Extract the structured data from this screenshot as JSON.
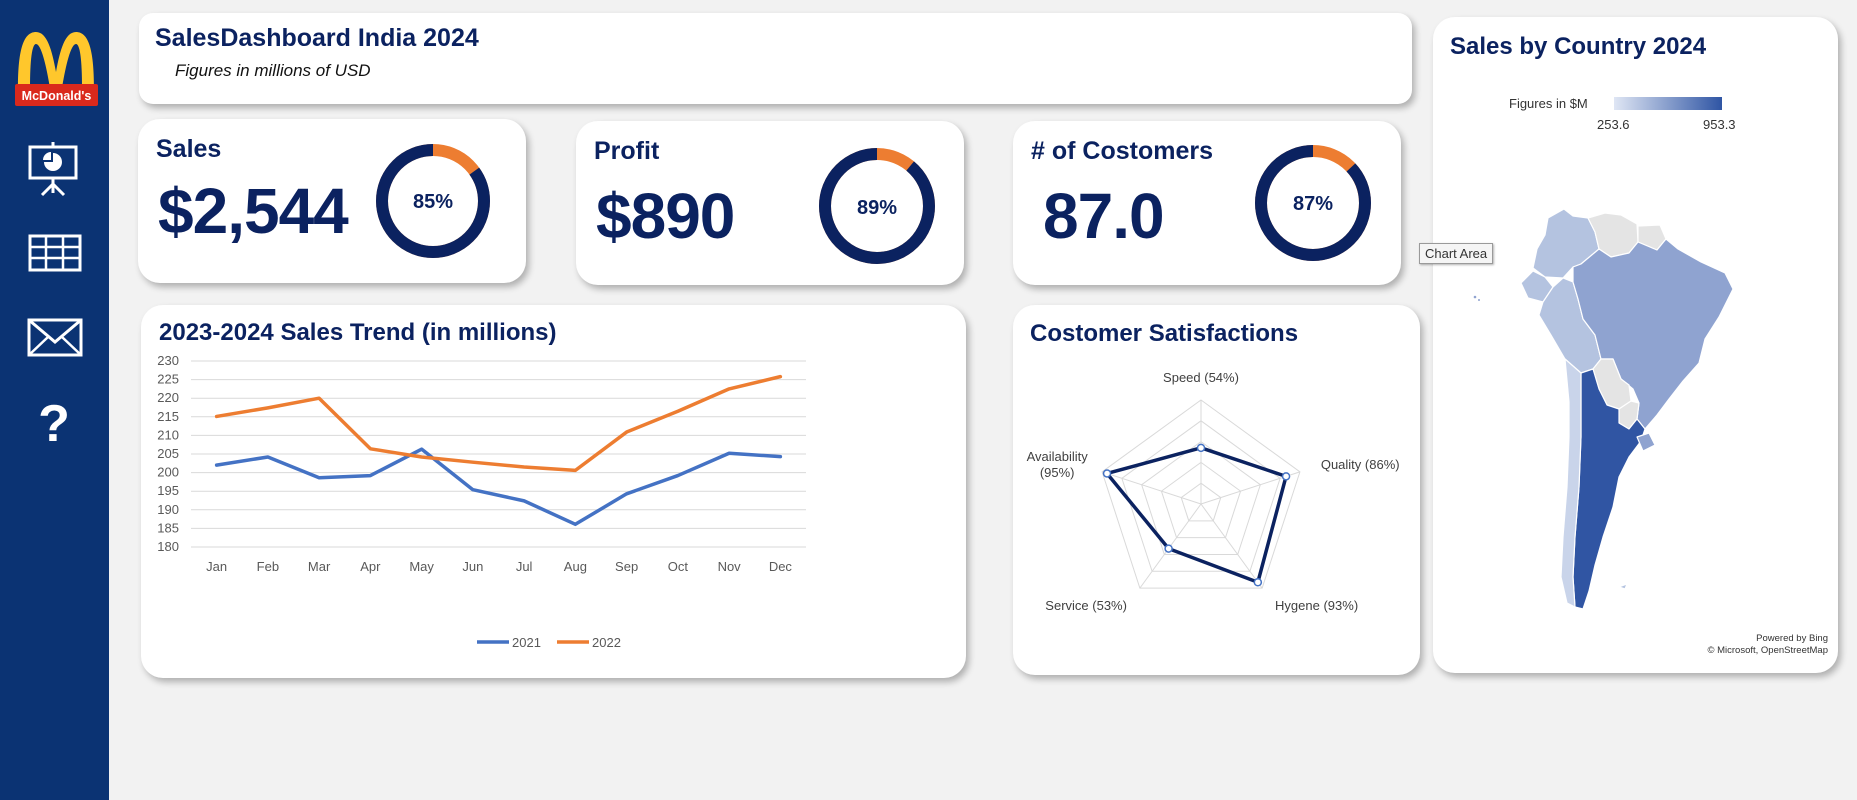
{
  "header": {
    "title": "SalesDashboard India 2024",
    "subtitle": "Figures in millions of USD"
  },
  "sidebar": {
    "logo_text": "McDonald's",
    "items": [
      {
        "icon": "presentation-icon"
      },
      {
        "icon": "table-icon"
      },
      {
        "icon": "mail-icon"
      },
      {
        "icon": "help-icon"
      }
    ]
  },
  "kpis": [
    {
      "label": "Sales",
      "value": "$2,544",
      "percent": 85,
      "percent_label": "85%"
    },
    {
      "label": "Profit",
      "value": "$890",
      "percent": 89,
      "percent_label": "89%"
    },
    {
      "label": "# of Costomers",
      "value": "87.0",
      "percent": 87,
      "percent_label": "87%"
    }
  ],
  "tooltip": {
    "text": "Chart Area"
  },
  "colors": {
    "navy": "#0b2260",
    "sidebar": "#0b3373",
    "orange": "#ed7d31",
    "blue": "#4472c4",
    "ring_dark": "#0b2260"
  },
  "chart_data": [
    {
      "type": "line",
      "title": "2023-2024 Sales Trend (in millions)",
      "categories": [
        "Jan",
        "Feb",
        "Mar",
        "Apr",
        "May",
        "Jun",
        "Jul",
        "Aug",
        "Sep",
        "Oct",
        "Nov",
        "Dec"
      ],
      "series": [
        {
          "name": "2021",
          "color": "#4472c4",
          "values": [
            202,
            204.2,
            198.6,
            199.2,
            206.3,
            195.4,
            192.4,
            186.1,
            194.3,
            199.2,
            205.2,
            204.3
          ]
        },
        {
          "name": "2022",
          "color": "#ed7d31",
          "values": [
            215.1,
            217.4,
            220,
            206.4,
            204.2,
            202.8,
            201.5,
            200.6,
            210.9,
            216.5,
            222.5,
            225.8
          ]
        }
      ],
      "ylim": [
        180,
        230
      ],
      "yticks": [
        180,
        185,
        190,
        195,
        200,
        205,
        210,
        215,
        220,
        225,
        230
      ],
      "grid": true,
      "legend": "bottom"
    },
    {
      "type": "radar",
      "title": "Costomer Satisfactions",
      "axes": [
        {
          "label": "Speed (54%)",
          "value": 54
        },
        {
          "label": "Quality (86%)",
          "value": 86
        },
        {
          "label": "Hygene (93%)",
          "value": 93
        },
        {
          "label": "Service (53%)",
          "value": 53
        },
        {
          "label": "Availability (95%)",
          "value": 95
        }
      ],
      "rmax": 100,
      "color": "#0b2260"
    },
    {
      "type": "map",
      "title": "Sales by Country 2024",
      "legend_title": "Figures in $M",
      "legend_min": "253.6",
      "legend_max": "953.3",
      "credit_line1": "Powered by Bing",
      "credit_line2": "© Microsoft, OpenStreetMap"
    }
  ]
}
